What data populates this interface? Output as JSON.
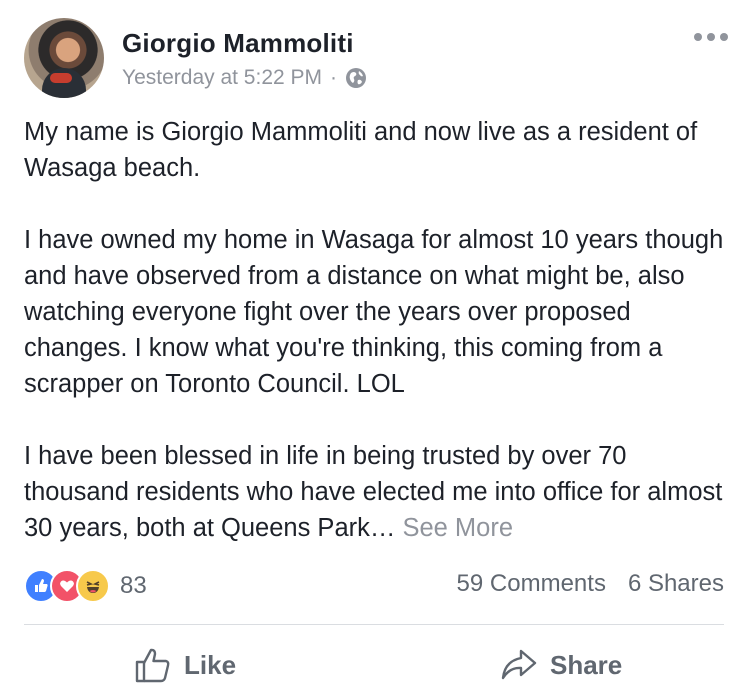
{
  "post": {
    "author": "Giorgio Mammoliti",
    "timestamp": "Yesterday at 5:22 PM",
    "separator": "·",
    "privacy_icon": "globe-icon",
    "paragraphs": [
      "My name is Giorgio Mammoliti and now live as a resident of Wasaga beach.",
      "I have owned my home in Wasaga for almost 10 years though and have observed from a distance on what might be, also watching everyone fight over the years over proposed changes.  I know what you're thinking, this coming from a scrapper on Toronto Council.  LOL"
    ],
    "truncated_paragraph": "I have been blessed in life in being trusted by over 70 thousand residents who have elected me into office for almost 30 years, both at Queens Park…",
    "see_more": "See More"
  },
  "stats": {
    "reaction_icons": [
      "like-icon",
      "love-icon",
      "haha-icon"
    ],
    "reaction_count": "83",
    "comments": "59 Comments",
    "shares": "6 Shares"
  },
  "actions": {
    "like_label": "Like",
    "share_label": "Share"
  },
  "colors": {
    "text": "#1d2129",
    "muted": "#90949c",
    "like_blue": "#4080ff",
    "love_red": "#f25268",
    "haha_yellow": "#f7c94b"
  }
}
